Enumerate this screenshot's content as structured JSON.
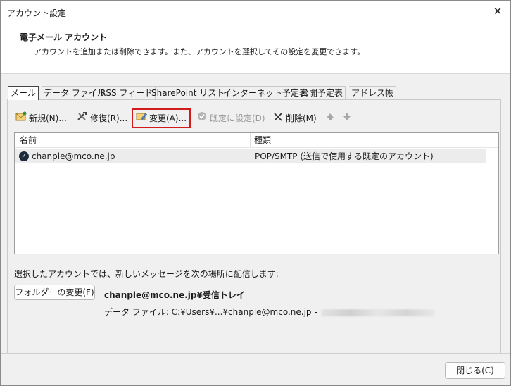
{
  "window": {
    "title": "アカウント設定",
    "close_glyph": "✕"
  },
  "header": {
    "title": "電子メール アカウント",
    "description": "アカウントを追加または削除できます。また、アカウントを選択してその設定を変更できます。"
  },
  "tabs": [
    {
      "label": "メール",
      "active": true
    },
    {
      "label": "データ ファイル"
    },
    {
      "label": "RSS フィード"
    },
    {
      "label": "SharePoint リスト"
    },
    {
      "label": "インターネット予定表"
    },
    {
      "label": "公開予定表"
    },
    {
      "label": "アドレス帳"
    }
  ],
  "toolbar": {
    "new_label": "新規(N)...",
    "repair_label": "修復(R)...",
    "change_label": "変更(A)...",
    "default_label": "既定に設定(D)",
    "delete_label": "削除(M)",
    "up_glyph": "🡅",
    "down_glyph": "🡇"
  },
  "list": {
    "columns": [
      "名前",
      "種類"
    ],
    "rows": [
      {
        "name": "chanple@mco.ne.jp",
        "type": "POP/SMTP (送信で使用する既定のアカウント)"
      }
    ]
  },
  "delivery": {
    "label": "選択したアカウントでは、新しいメッセージを次の場所に配信します:",
    "folder_button": "フォルダーの変更(F)",
    "path": "chanple@mco.ne.jp¥受信トレイ",
    "data_file": "データ ファイル: C:¥Users¥...¥chanple@mco.ne.jp -"
  },
  "footer": {
    "close_label": "閉じる(C)"
  },
  "colors": {
    "highlight_border": "#d21c1c",
    "selected_row": "#ececec"
  }
}
